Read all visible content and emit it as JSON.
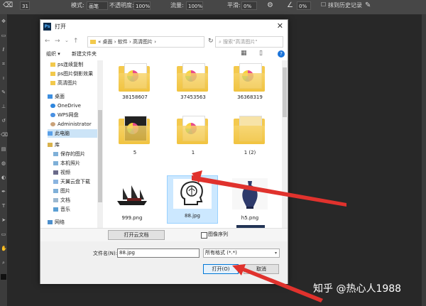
{
  "ps_toolbar": {
    "items": [
      {
        "label": "模式:",
        "value": "画笔"
      },
      {
        "label": "不透明度:",
        "value": "100%"
      },
      {
        "label": "流量:",
        "value": "100%"
      },
      {
        "label": "平滑:",
        "value": "0%"
      },
      {
        "label": "抹到历史记录",
        "value": ""
      }
    ],
    "brush_size": "31"
  },
  "dialog": {
    "title": "打开",
    "breadcrumb": "« 桌面 › 软件 › 高清图片 ›",
    "search_placeholder": "搜索\"高清图片\"",
    "organize": "组织 ▾",
    "new_folder": "新建文件夹",
    "sidebar": [
      {
        "label": "ps连续复制"
      },
      {
        "label": "ps图片倒影效果"
      },
      {
        "label": "高清图片"
      },
      {
        "label": "桌面"
      },
      {
        "label": "OneDrive"
      },
      {
        "label": "WPS网盘"
      },
      {
        "label": "Administrator"
      },
      {
        "label": "此电脑"
      },
      {
        "label": "库"
      },
      {
        "label": "保存的图片"
      },
      {
        "label": "本机照片"
      },
      {
        "label": "视频"
      },
      {
        "label": "天翼云盘下载"
      },
      {
        "label": "图片"
      },
      {
        "label": "文档"
      },
      {
        "label": "音乐"
      },
      {
        "label": "网络"
      }
    ],
    "files": [
      {
        "name": "38158607",
        "kind": "folder"
      },
      {
        "name": "37453563",
        "kind": "folder"
      },
      {
        "name": "36368319",
        "kind": "folder"
      },
      {
        "name": "5",
        "kind": "folder"
      },
      {
        "name": "1",
        "kind": "folder"
      },
      {
        "name": "1 (2)",
        "kind": "folder"
      },
      {
        "name": "999.png",
        "kind": "image"
      },
      {
        "name": "88.jpg",
        "kind": "image",
        "selected": true
      },
      {
        "name": "h5.png",
        "kind": "image"
      }
    ],
    "cloud_button": "打开云文档",
    "preview_label": "图像序列",
    "filename_label": "文件名(N):",
    "filename_value": "88.jpg",
    "filetype_value": "所有格式 (*.*)",
    "open_button": "打开(O)",
    "cancel_button": "取消"
  },
  "watermark": "知乎 @热心人1988",
  "colors": {
    "accent": "#0078d7",
    "arrow": "#e0322d",
    "folder": "#f4c94d"
  }
}
